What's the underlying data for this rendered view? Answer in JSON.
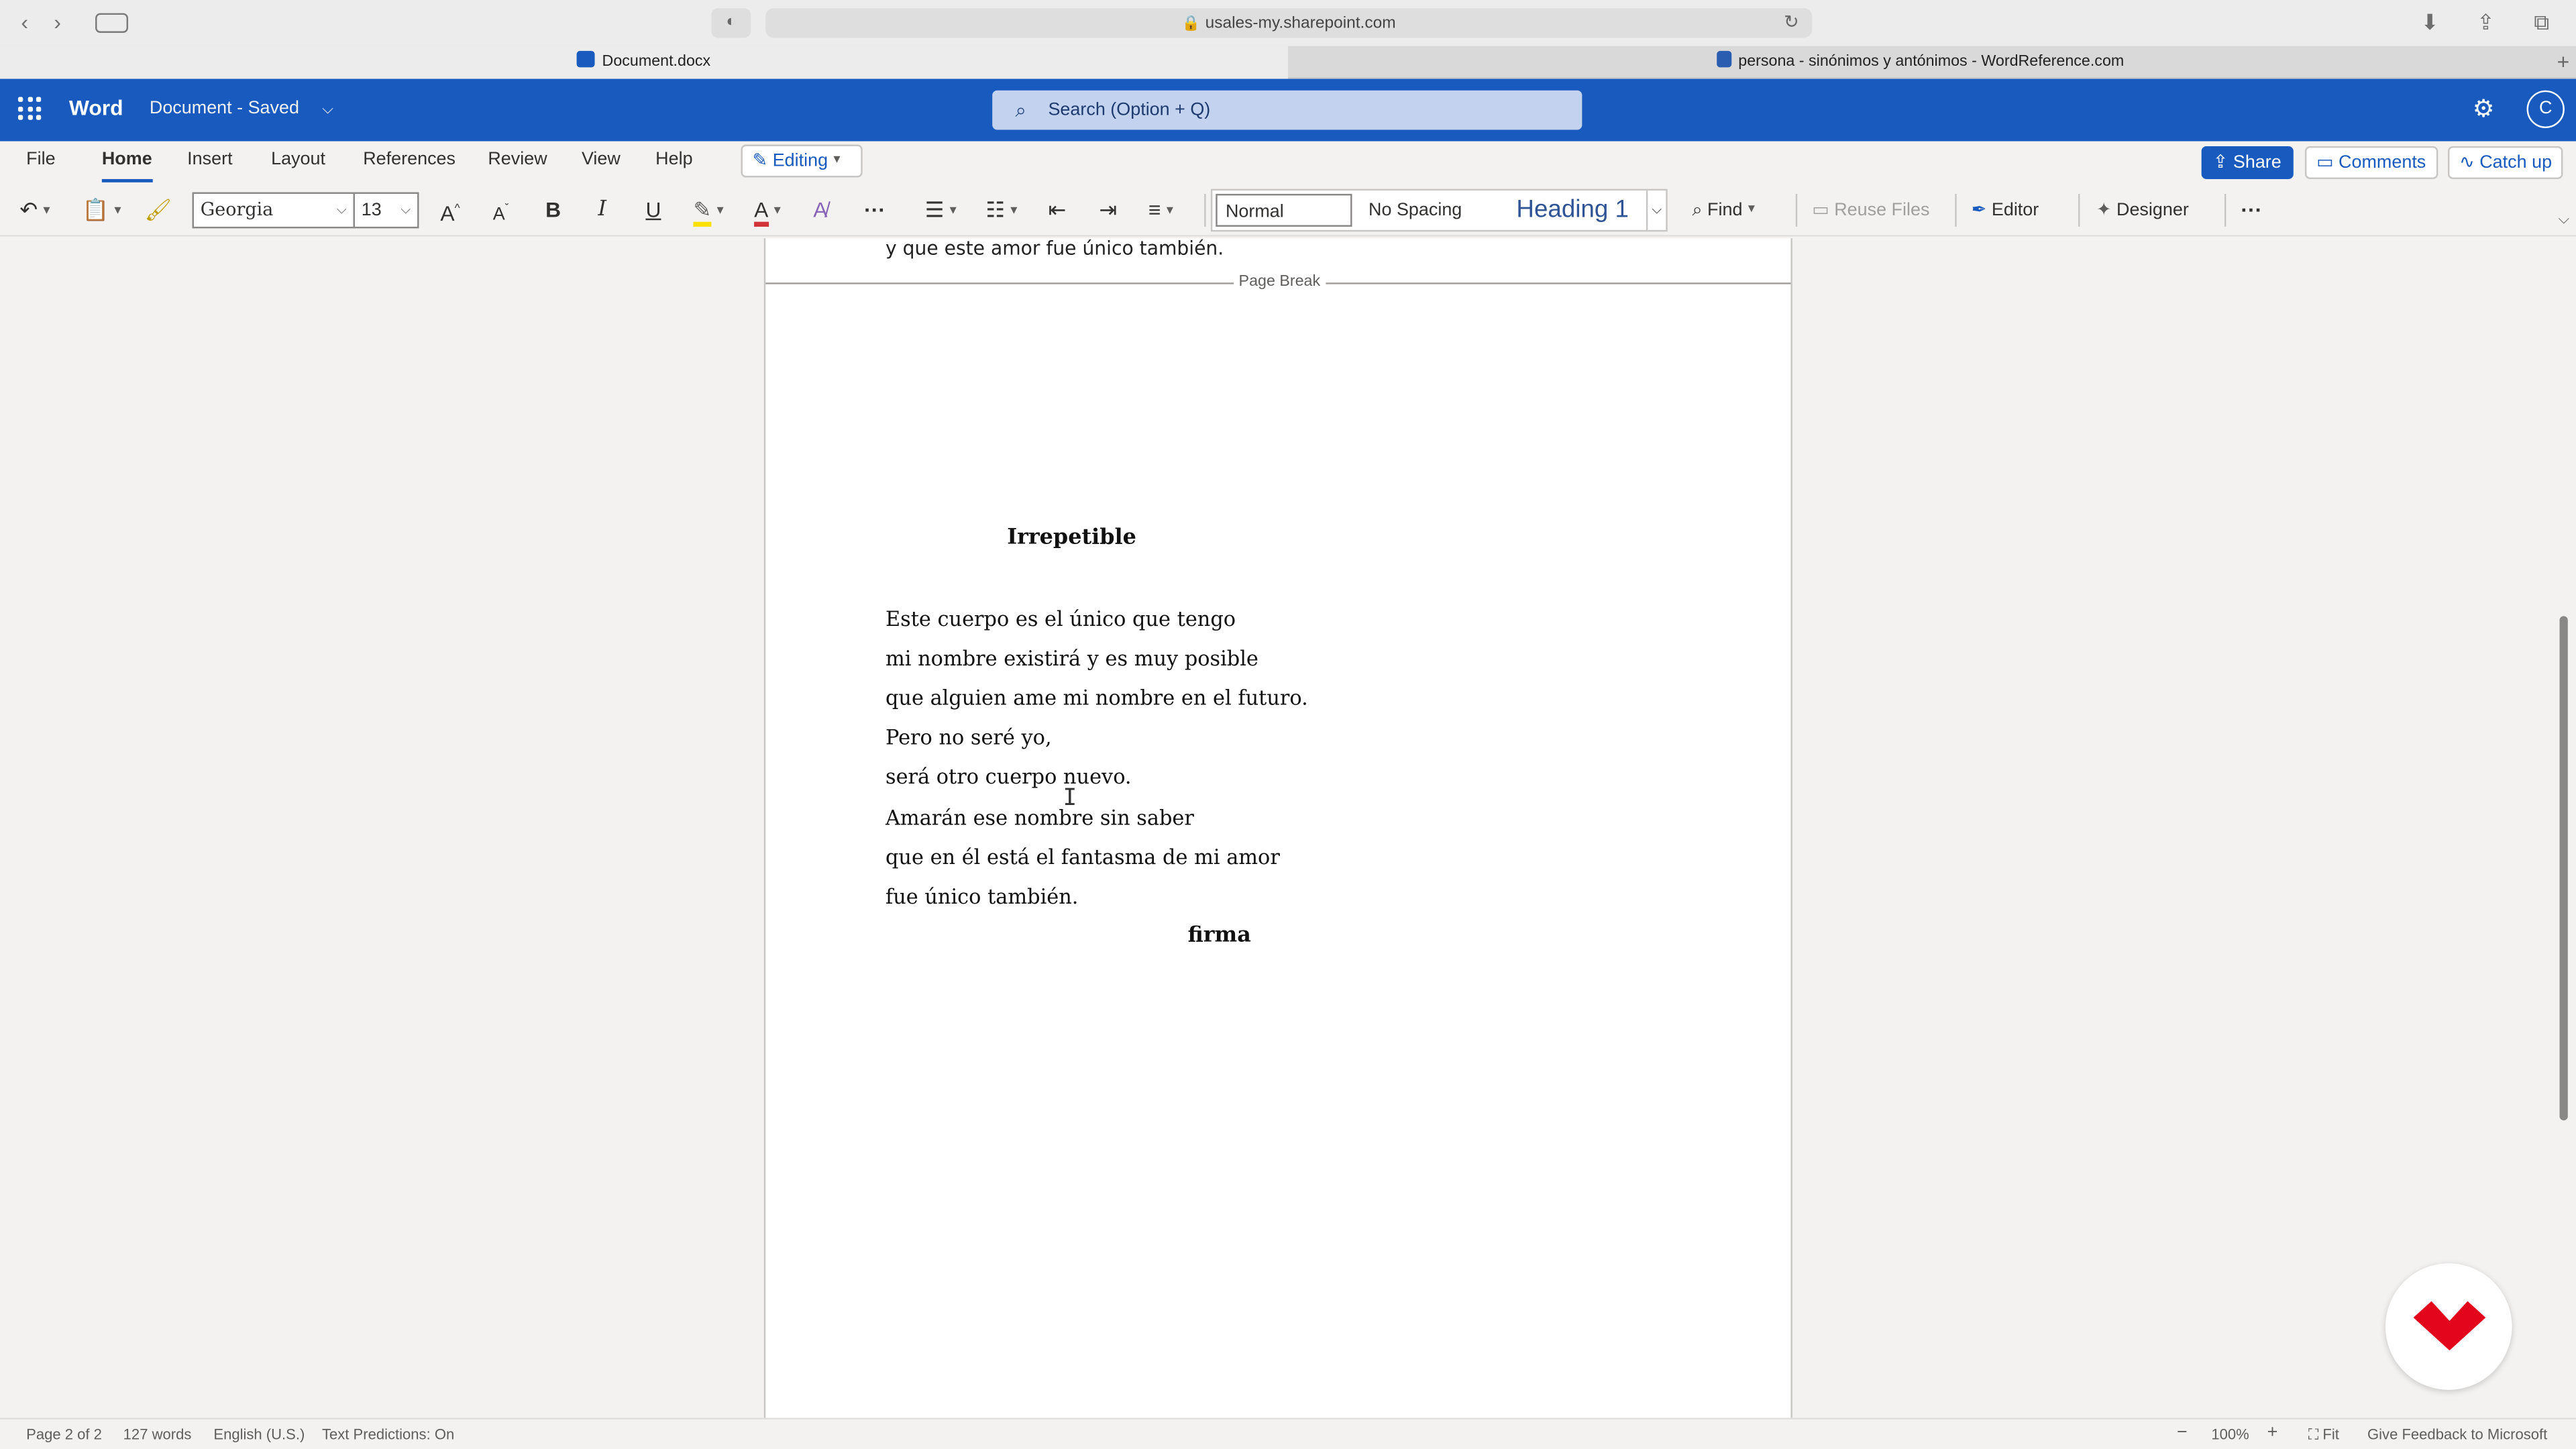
{
  "browser": {
    "url": "usales-my.sharepoint.com",
    "tabs": [
      {
        "label": "Document.docx",
        "active": true
      },
      {
        "label": "persona - sinónimos y antónimos - WordReference.com",
        "active": false
      }
    ]
  },
  "header": {
    "app_name": "Word",
    "doc_status": "Document - Saved",
    "search_placeholder": "Search (Option + Q)",
    "avatar_letter": "C"
  },
  "ribbon": {
    "tabs": [
      "File",
      "Home",
      "Insert",
      "Layout",
      "References",
      "Review",
      "View",
      "Help"
    ],
    "active_tab": "Home",
    "editing_label": "Editing",
    "share_label": "Share",
    "comments_label": "Comments",
    "catchup_label": "Catch up",
    "font_name": "Georgia",
    "font_size": "13",
    "styles": [
      "Normal",
      "No Spacing",
      "Heading 1"
    ],
    "find_label": "Find",
    "reuse_files_label": "Reuse Files",
    "editor_label": "Editor",
    "designer_label": "Designer"
  },
  "document": {
    "prev_page_last_line": "y que este amor fue único también.",
    "page_break_label": "Page Break",
    "title": "Irrepetible",
    "lines": [
      "Este cuerpo es el único que tengo",
      "mi nombre existirá y es muy posible",
      "que alguien ame mi nombre en el futuro.",
      "Pero no seré yo,",
      "será otro cuerpo nuevo.",
      "Amarán ese nombre sin saber",
      "que en él está el fantasma de mi amor",
      "fue único también."
    ],
    "signature": "firma"
  },
  "status_bar": {
    "page": "Page 2 of 2",
    "words": "127 words",
    "language": "English (U.S.)",
    "predictions": "Text Predictions: On",
    "zoom": "100%",
    "fit_label": "Fit",
    "feedback": "Give Feedback to Microsoft"
  },
  "colors": {
    "word_blue": "#185abd",
    "brand_red": "#e3051b"
  }
}
